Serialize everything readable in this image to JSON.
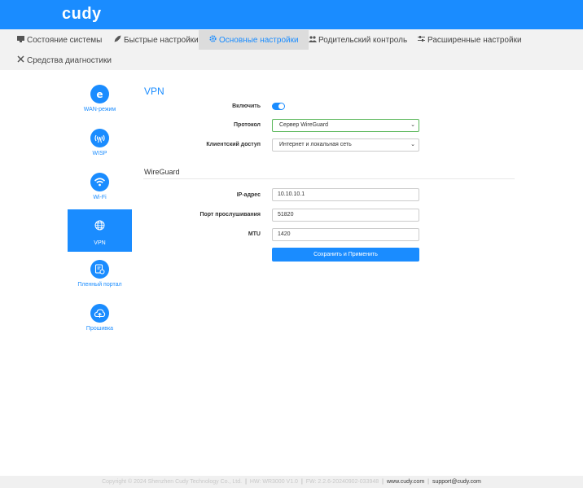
{
  "brand": {
    "logo_text": "cudy",
    "primary_color": "#1a8cff"
  },
  "nav": {
    "items": [
      {
        "icon": "monitor-icon",
        "label": "Состояние системы"
      },
      {
        "icon": "rocket-icon",
        "label": "Быстрые настройки"
      },
      {
        "icon": "gear-icon",
        "label": "Основные настройки",
        "active": true
      },
      {
        "icon": "users-icon",
        "label": "Родительский контроль"
      },
      {
        "icon": "sliders-icon",
        "label": "Расширенные настройки"
      },
      {
        "icon": "tools-icon",
        "label": "Средства диагностики"
      }
    ]
  },
  "sidebar": {
    "items": [
      {
        "icon": "internet-explorer-icon",
        "label": "WAN-режим"
      },
      {
        "icon": "antenna-icon",
        "label": "WISP"
      },
      {
        "icon": "wifi-icon",
        "label": "Wi-Fi"
      },
      {
        "icon": "globe-icon",
        "label": "VPN",
        "active": true
      },
      {
        "icon": "portal-icon",
        "label": "Пленный портал"
      },
      {
        "icon": "cloud-upload-icon",
        "label": "Прошивка"
      }
    ]
  },
  "vpn": {
    "title": "VPN",
    "enable_label": "Включить",
    "enabled": true,
    "protocol_label": "Протокол",
    "protocol_value": "Сервер WireGuard",
    "client_access_label": "Клиентский доступ",
    "client_access_value": "Интернет и локальная сеть"
  },
  "wireguard": {
    "title": "WireGuard",
    "ip_label": "IP-адрес",
    "ip_value": "10.10.10.1",
    "port_label": "Порт прослушивания",
    "port_value": "51820",
    "mtu_label": "MTU",
    "mtu_value": "1420",
    "save_label": "Сохранить и Применить"
  },
  "footer": {
    "copyright": "Copyright © 2024 Shenzhen Cudy Technology Co., Ltd.",
    "hw": "HW: WR3000 V1.0",
    "fw": "FW: 2.2.6-20240902-033948",
    "site": "www.cudy.com",
    "support": "support@cudy.com"
  }
}
